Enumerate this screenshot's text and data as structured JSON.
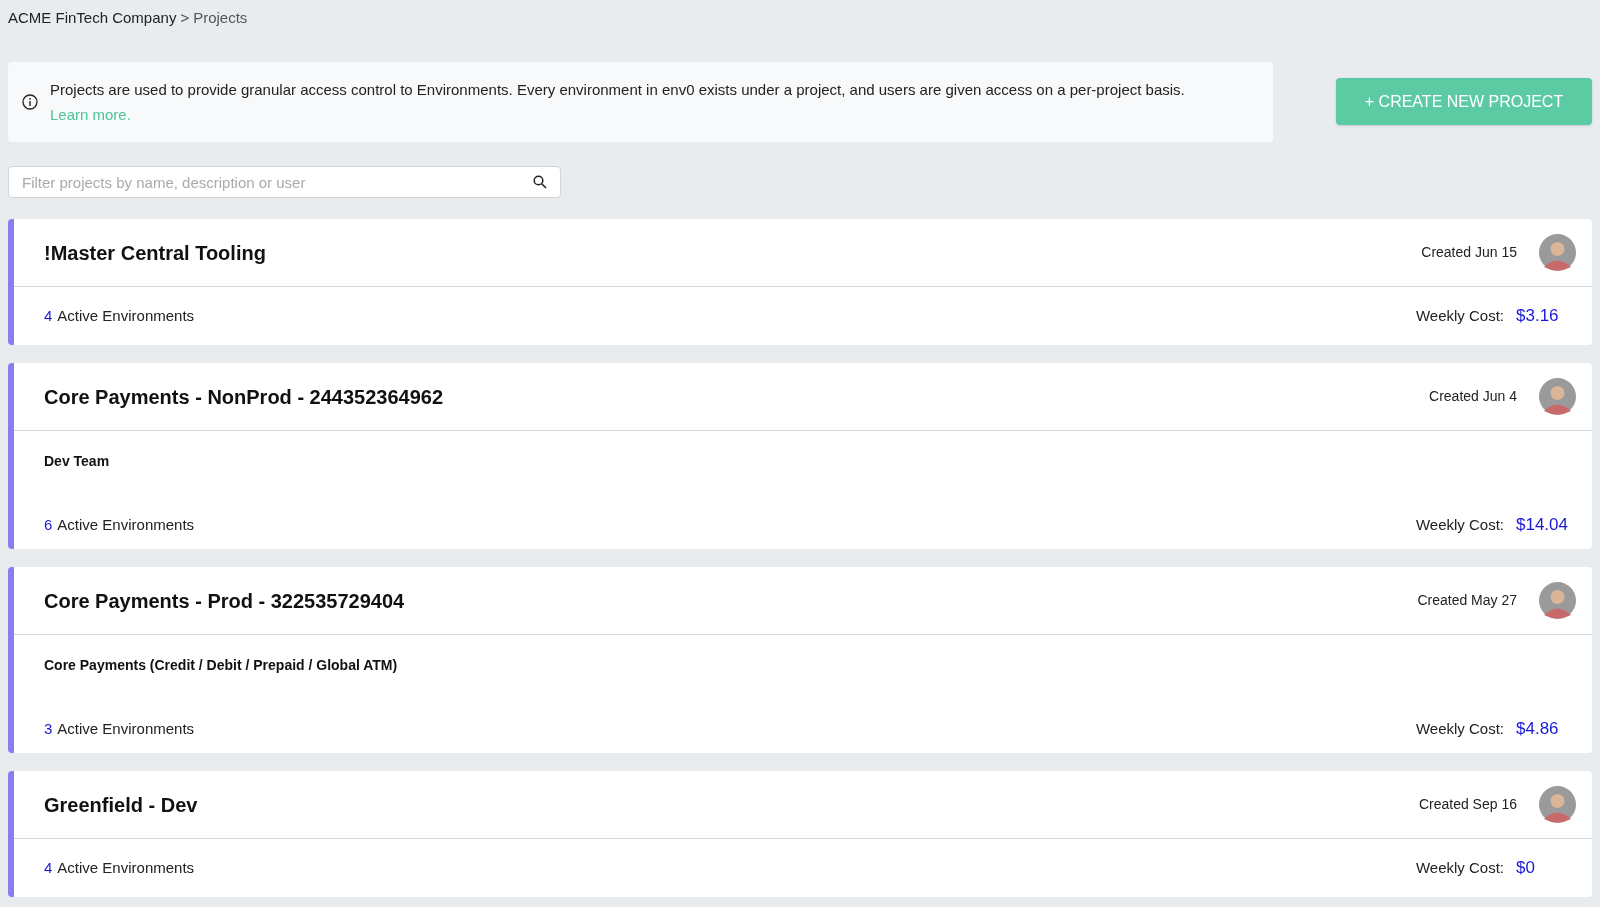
{
  "breadcrumb": {
    "parent": "ACME FinTech Company",
    "separator": ">",
    "current": "Projects"
  },
  "info_banner": {
    "text": "Projects are used to provide granular access control to Environments. Every environment in env0 exists under a project, and users are given access on a per-project basis.",
    "link": "Learn more."
  },
  "create_button": "+ CREATE NEW PROJECT",
  "search": {
    "placeholder": "Filter projects by name, description or user"
  },
  "projects": [
    {
      "name": "!Master Central Tooling",
      "created": "Created Jun 15",
      "active_count": "4",
      "active_label": "Active Environments",
      "cost_label": "Weekly Cost:",
      "cost": "$3.16"
    },
    {
      "name": "Core Payments - NonProd - 244352364962",
      "created": "Created Jun 4",
      "description": "Dev Team",
      "active_count": "6",
      "active_label": "Active Environments",
      "cost_label": "Weekly Cost:",
      "cost": "$14.04"
    },
    {
      "name": "Core Payments - Prod - 322535729404",
      "created": "Created May 27",
      "description": "Core Payments (Credit / Debit / Prepaid / Global ATM)",
      "active_count": "3",
      "active_label": "Active Environments",
      "cost_label": "Weekly Cost:",
      "cost": "$4.86"
    },
    {
      "name": "Greenfield - Dev",
      "created": "Created Sep 16",
      "active_count": "4",
      "active_label": "Active Environments",
      "cost_label": "Weekly Cost:",
      "cost": "$0"
    }
  ]
}
